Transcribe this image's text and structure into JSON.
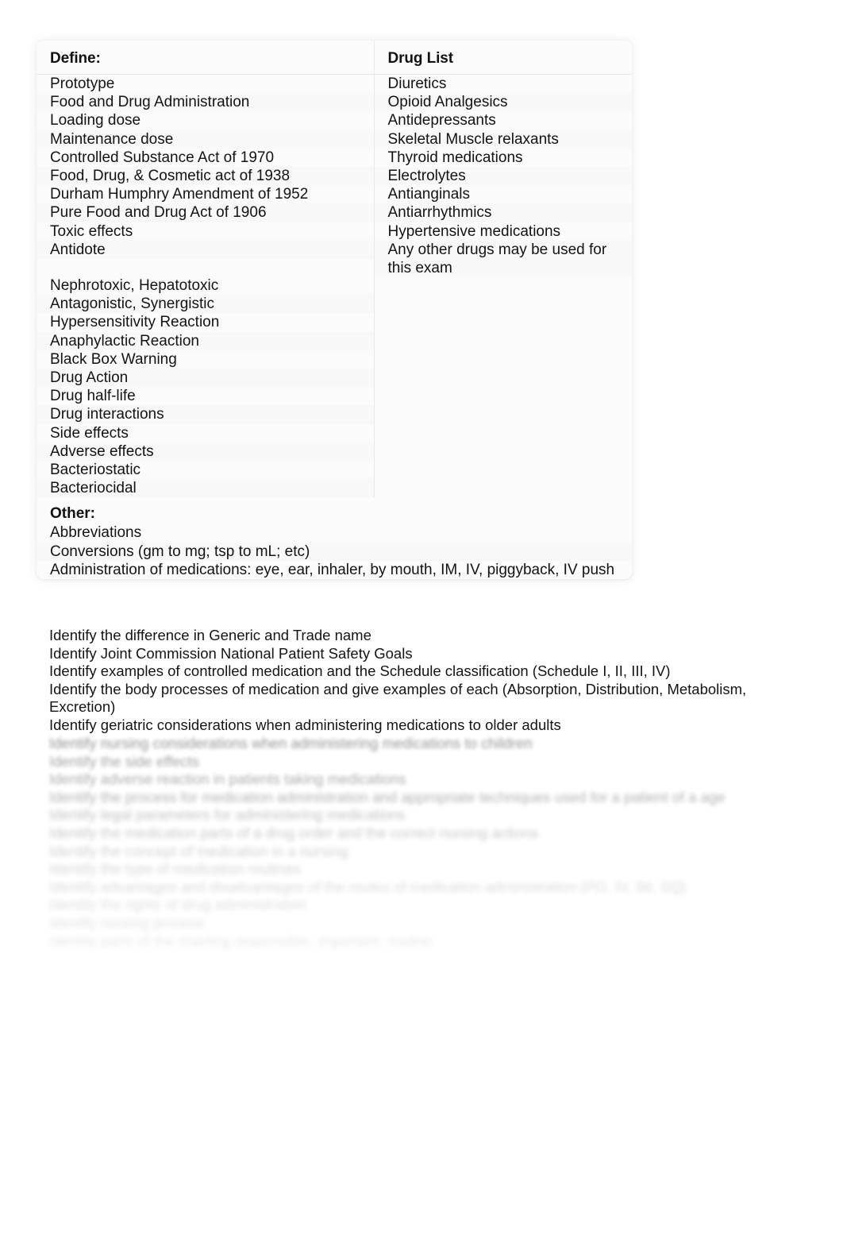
{
  "study_table": {
    "headers": {
      "left": "Define:",
      "right": "Drug List"
    },
    "define_items": [
      "Prototype",
      "Food and Drug Administration",
      "Loading dose",
      "Maintenance dose",
      "Controlled Substance Act of 1970",
      "Food, Drug, & Cosmetic act of 1938",
      "Durham Humphry Amendment of 1952",
      "Pure Food and Drug Act of 1906",
      "Toxic effects",
      "Antidote"
    ],
    "define_items_second": [
      "Nephrotoxic, Hepatotoxic",
      "Antagonistic, Synergistic",
      "Hypersensitivity Reaction",
      "Anaphylactic Reaction",
      "Black Box Warning",
      "Drug Action",
      "Drug half-life",
      "Drug interactions",
      "Side effects",
      "Adverse effects",
      "Bacteriostatic",
      "Bacteriocidal"
    ],
    "drug_list_items": [
      "Diuretics",
      "Opioid Analgesics",
      "Antidepressants",
      "Skeletal Muscle relaxants",
      "Thyroid medications",
      "Electrolytes",
      "Antianginals",
      "Antiarrhythmics",
      "Hypertensive medications",
      "Any other drugs may be used for this exam"
    ],
    "other": {
      "heading": "Other:",
      "items": [
        "Abbreviations",
        "Conversions (gm to mg; tsp to mL; etc)",
        "Administration of medications: eye, ear, inhaler, by mouth, IM, IV, piggyback, IV push"
      ]
    }
  },
  "objectives": [
    "Identify the difference in Generic and Trade name",
    "Identify Joint Commission National Patient Safety Goals",
    "Identify examples of controlled medication and the Schedule classification (Schedule I, II, III, IV)",
    "Identify the body processes of medication and give examples of each (Absorption, Distribution, Metabolism, Excretion)",
    "Identify geriatric considerations when administering medications to older adults"
  ],
  "obscured_objectives": [
    "Identify nursing considerations when administering medications to children",
    "Identify the side effects",
    "Identify adverse reaction in patients taking medications",
    "Identify the process for medication administration and appropriate techniques used for a patient of a age",
    "Identify legal parameters for administering medications",
    "Identify the medication parts of a drug order and the correct nursing actions",
    "Identify the concept of medication in a nursing",
    "Identify the type of medication routines",
    "Identify advantages and disadvantages of the routes of medication administration (PO, IV, IM, SQ)",
    "Identify the rights of drug administration",
    "Identify nursing process",
    "Identify parts of the charting responsible, important, routine"
  ]
}
